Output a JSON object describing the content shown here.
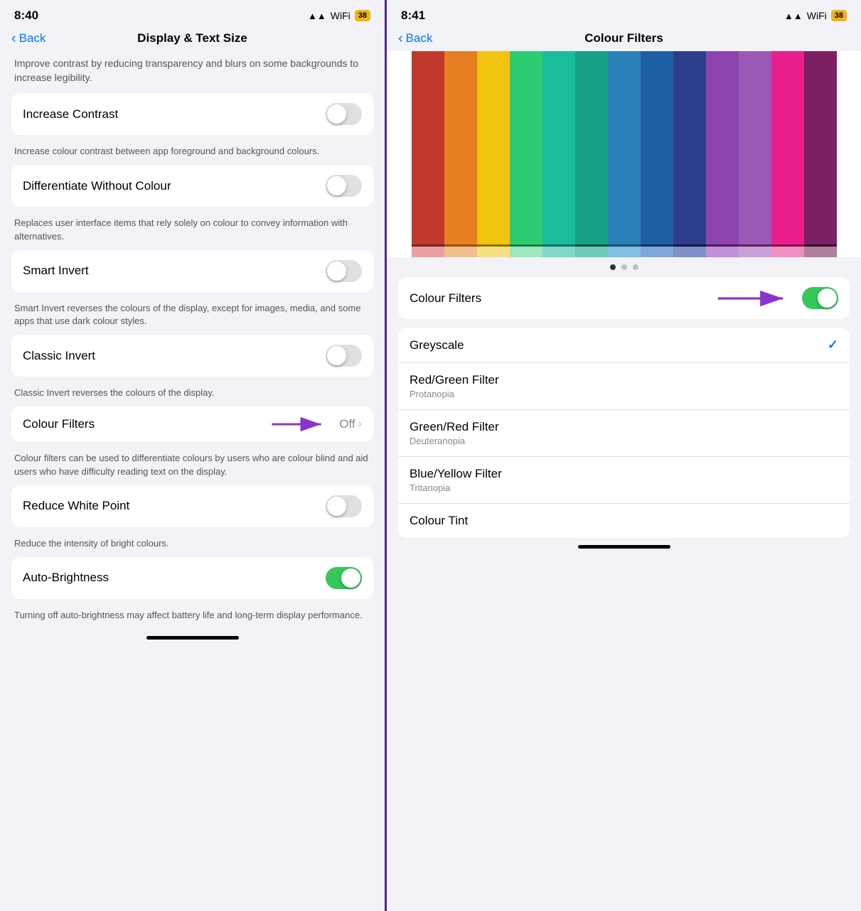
{
  "left": {
    "status": {
      "time": "8:40",
      "battery": "38"
    },
    "nav": {
      "back": "Back",
      "title": "Display & Text Size"
    },
    "top_desc": "Improve contrast by reducing transparency and blurs on some backgrounds to increase legibility.",
    "settings": [
      {
        "id": "increase-contrast",
        "label": "Increase Contrast",
        "toggle": false,
        "desc": "Increase colour contrast between app foreground and background colours."
      },
      {
        "id": "differentiate-without-colour",
        "label": "Differentiate Without Colour",
        "toggle": false,
        "desc": "Replaces user interface items that rely solely on colour to convey information with alternatives."
      },
      {
        "id": "smart-invert",
        "label": "Smart Invert",
        "toggle": false,
        "desc": "Smart Invert reverses the colours of the display, except for images, media, and some apps that use dark colour styles."
      },
      {
        "id": "classic-invert",
        "label": "Classic Invert",
        "toggle": false,
        "desc": "Classic Invert reverses the colours of the display."
      },
      {
        "id": "colour-filters",
        "label": "Colour Filters",
        "value": "Off",
        "desc": "Colour filters can be used to differentiate colours by users who are colour blind and aid users who have difficulty reading text on the display."
      },
      {
        "id": "reduce-white-point",
        "label": "Reduce White Point",
        "toggle": false,
        "desc": "Reduce the intensity of bright colours."
      },
      {
        "id": "auto-brightness",
        "label": "Auto-Brightness",
        "toggle": true,
        "desc": "Turning off auto-brightness may affect battery life and long-term display performance."
      }
    ]
  },
  "right": {
    "status": {
      "time": "8:41",
      "battery": "38"
    },
    "nav": {
      "back": "Back",
      "title": "Colour Filters"
    },
    "pencils": [
      {
        "color": "#c0392b",
        "tip": "#7b241c",
        "eraser": "#e8a0a0"
      },
      {
        "color": "#e67e22",
        "tip": "#9a4f0a",
        "eraser": "#f0c090"
      },
      {
        "color": "#f1c40f",
        "tip": "#8a7000",
        "eraser": "#f7e080"
      },
      {
        "color": "#2ecc71",
        "tip": "#1a7a40",
        "eraser": "#a0e8c0"
      },
      {
        "color": "#1abc9c",
        "tip": "#0e7060",
        "eraser": "#80d8c8"
      },
      {
        "color": "#16a085",
        "tip": "#0a5040",
        "eraser": "#70c8b8"
      },
      {
        "color": "#2980b9",
        "tip": "#1a5070",
        "eraser": "#80c0e0"
      },
      {
        "color": "#1f5fa6",
        "tip": "#0e3060",
        "eraser": "#80a8d8"
      },
      {
        "color": "#2c3e8c",
        "tip": "#101840",
        "eraser": "#8090c8"
      },
      {
        "color": "#8e44ad",
        "tip": "#4a1a60",
        "eraser": "#c090d8"
      },
      {
        "color": "#9b59b6",
        "tip": "#5a2070",
        "eraser": "#c8a0d8"
      },
      {
        "color": "#e91e8c",
        "tip": "#8a0a50",
        "eraser": "#f090c0"
      },
      {
        "color": "#7b2063",
        "tip": "#3a0a30",
        "eraser": "#b080a0"
      }
    ],
    "dots": [
      {
        "active": true
      },
      {
        "active": false
      },
      {
        "active": false
      }
    ],
    "colour_filters_toggle": {
      "label": "Colour Filters",
      "on": true
    },
    "filters": [
      {
        "id": "greyscale",
        "name": "Greyscale",
        "sub": "",
        "selected": true
      },
      {
        "id": "red-green",
        "name": "Red/Green Filter",
        "sub": "Protanopia",
        "selected": false
      },
      {
        "id": "green-red",
        "name": "Green/Red Filter",
        "sub": "Deuteranopia",
        "selected": false
      },
      {
        "id": "blue-yellow",
        "name": "Blue/Yellow Filter",
        "sub": "Tritanopia",
        "selected": false
      },
      {
        "id": "colour-tint",
        "name": "Colour Tint",
        "sub": "",
        "selected": false
      }
    ]
  }
}
